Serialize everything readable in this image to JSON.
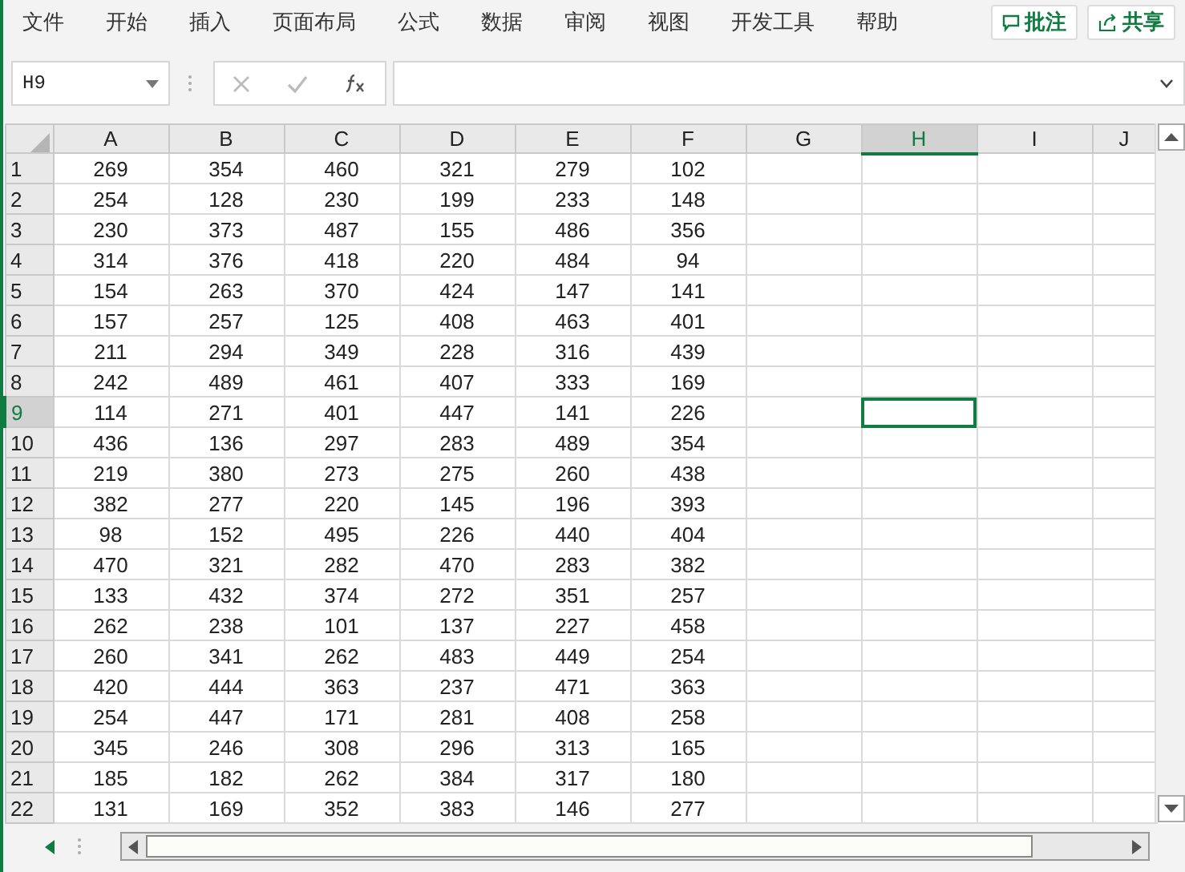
{
  "menu": [
    "文件",
    "开始",
    "插入",
    "页面布局",
    "公式",
    "数据",
    "审阅",
    "视图",
    "开发工具",
    "帮助"
  ],
  "actions": [
    {
      "kind": "comment",
      "label": "批注"
    },
    {
      "kind": "share",
      "label": "共享"
    }
  ],
  "formula_bar": {
    "name_box": "H9"
  },
  "columns": [
    {
      "label": "A",
      "selected": false
    },
    {
      "label": "B",
      "selected": false
    },
    {
      "label": "C",
      "selected": false
    },
    {
      "label": "D",
      "selected": false
    },
    {
      "label": "E",
      "selected": false
    },
    {
      "label": "F",
      "selected": false
    },
    {
      "label": "G",
      "selected": false
    },
    {
      "label": "H",
      "selected": true
    },
    {
      "label": "I",
      "selected": false
    },
    {
      "label": "J",
      "selected": false
    }
  ],
  "rows": [
    {
      "label": "1",
      "selected": false,
      "cells": [
        "269",
        "354",
        "460",
        "321",
        "279",
        "102"
      ]
    },
    {
      "label": "2",
      "selected": false,
      "cells": [
        "254",
        "128",
        "230",
        "199",
        "233",
        "148"
      ]
    },
    {
      "label": "3",
      "selected": false,
      "cells": [
        "230",
        "373",
        "487",
        "155",
        "486",
        "356"
      ]
    },
    {
      "label": "4",
      "selected": false,
      "cells": [
        "314",
        "376",
        "418",
        "220",
        "484",
        "94"
      ]
    },
    {
      "label": "5",
      "selected": false,
      "cells": [
        "154",
        "263",
        "370",
        "424",
        "147",
        "141"
      ]
    },
    {
      "label": "6",
      "selected": false,
      "cells": [
        "157",
        "257",
        "125",
        "408",
        "463",
        "401"
      ]
    },
    {
      "label": "7",
      "selected": false,
      "cells": [
        "211",
        "294",
        "349",
        "228",
        "316",
        "439"
      ]
    },
    {
      "label": "8",
      "selected": false,
      "cells": [
        "242",
        "489",
        "461",
        "407",
        "333",
        "169"
      ]
    },
    {
      "label": "9",
      "selected": true,
      "cells": [
        "114",
        "271",
        "401",
        "447",
        "141",
        "226"
      ]
    },
    {
      "label": "10",
      "selected": false,
      "cells": [
        "436",
        "136",
        "297",
        "283",
        "489",
        "354"
      ]
    },
    {
      "label": "11",
      "selected": false,
      "cells": [
        "219",
        "380",
        "273",
        "275",
        "260",
        "438"
      ]
    },
    {
      "label": "12",
      "selected": false,
      "cells": [
        "382",
        "277",
        "220",
        "145",
        "196",
        "393"
      ]
    },
    {
      "label": "13",
      "selected": false,
      "cells": [
        "98",
        "152",
        "495",
        "226",
        "440",
        "404"
      ]
    },
    {
      "label": "14",
      "selected": false,
      "cells": [
        "470",
        "321",
        "282",
        "470",
        "283",
        "382"
      ]
    },
    {
      "label": "15",
      "selected": false,
      "cells": [
        "133",
        "432",
        "374",
        "272",
        "351",
        "257"
      ]
    },
    {
      "label": "16",
      "selected": false,
      "cells": [
        "262",
        "238",
        "101",
        "137",
        "227",
        "458"
      ]
    },
    {
      "label": "17",
      "selected": false,
      "cells": [
        "260",
        "341",
        "262",
        "483",
        "449",
        "254"
      ]
    },
    {
      "label": "18",
      "selected": false,
      "cells": [
        "420",
        "444",
        "363",
        "237",
        "471",
        "363"
      ]
    },
    {
      "label": "19",
      "selected": false,
      "cells": [
        "254",
        "447",
        "171",
        "281",
        "408",
        "258"
      ]
    },
    {
      "label": "20",
      "selected": false,
      "cells": [
        "345",
        "246",
        "308",
        "296",
        "313",
        "165"
      ]
    },
    {
      "label": "21",
      "selected": false,
      "cells": [
        "185",
        "182",
        "262",
        "384",
        "317",
        "180"
      ]
    },
    {
      "label": "22",
      "selected": false,
      "cells": [
        "131",
        "169",
        "352",
        "383",
        "146",
        "277"
      ]
    }
  ]
}
